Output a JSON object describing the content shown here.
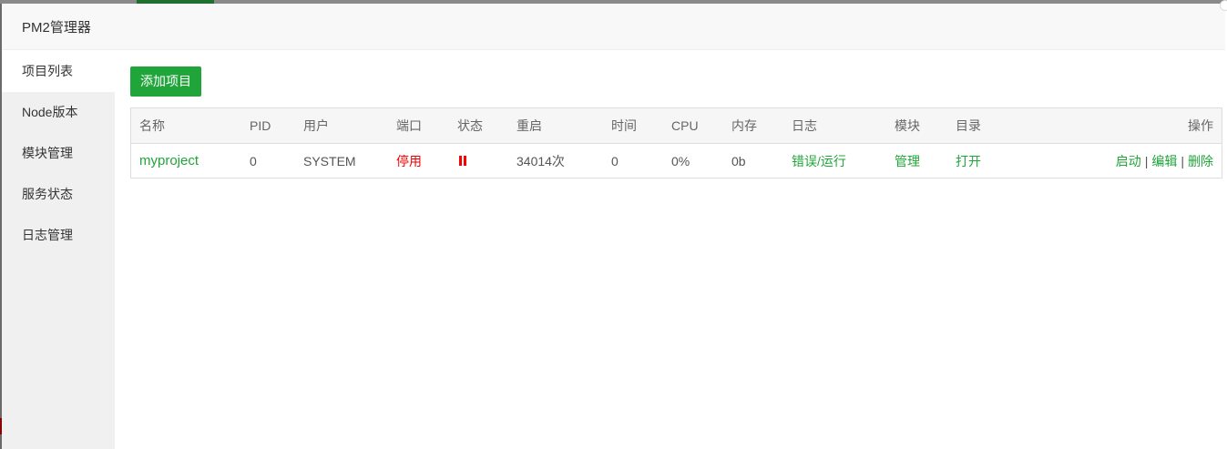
{
  "window": {
    "title": "PM2管理器"
  },
  "sidebar": {
    "items": [
      {
        "label": "项目列表",
        "active": true
      },
      {
        "label": "Node版本",
        "active": false
      },
      {
        "label": "模块管理",
        "active": false
      },
      {
        "label": "服务状态",
        "active": false
      },
      {
        "label": "日志管理",
        "active": false
      }
    ]
  },
  "toolbar": {
    "add_label": "添加项目"
  },
  "table": {
    "headers": [
      "名称",
      "PID",
      "用户",
      "端口",
      "状态",
      "重启",
      "时间",
      "CPU",
      "内存",
      "日志",
      "模块",
      "目录",
      "操作"
    ],
    "rows": [
      {
        "name": "myproject",
        "pid": "0",
        "user": "SYSTEM",
        "port": "停用",
        "status_icon": "pause-icon",
        "restart": "34014次",
        "time": "0",
        "cpu": "0%",
        "memory": "0b",
        "log_error": "错误",
        "log_sep": "/",
        "log_run": "运行",
        "module": "管理",
        "directory": "打开",
        "actions": {
          "start": "启动",
          "sep1": "|",
          "edit": "编辑",
          "sep2": "|",
          "delete": "删除"
        }
      }
    ]
  },
  "colors": {
    "accent": "#20a53a",
    "danger": "#ff0000",
    "sidebar_bg": "#f0f0f0"
  }
}
